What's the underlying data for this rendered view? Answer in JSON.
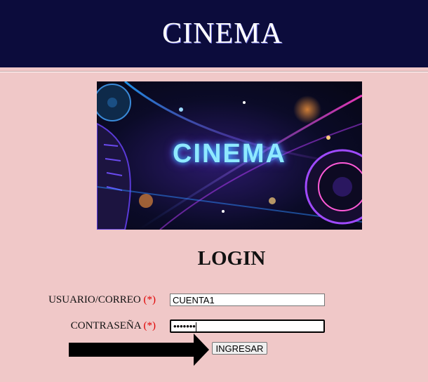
{
  "header": {
    "title": "CINEMA"
  },
  "banner": {
    "text": "CINEMA"
  },
  "login": {
    "title": "LOGIN",
    "user_label": "USUARIO/CORREO",
    "password_label": "CONTRASEÑA",
    "required_mark": "(*)",
    "user_value": "CUENTA1",
    "password_value": "•••••••",
    "submit_label": "INGRESAR"
  },
  "colors": {
    "header_bg": "#0c0c3c",
    "page_bg": "#f0c8c8",
    "required": "#e00000"
  },
  "icons": {
    "pointer": "arrow-right-icon"
  }
}
